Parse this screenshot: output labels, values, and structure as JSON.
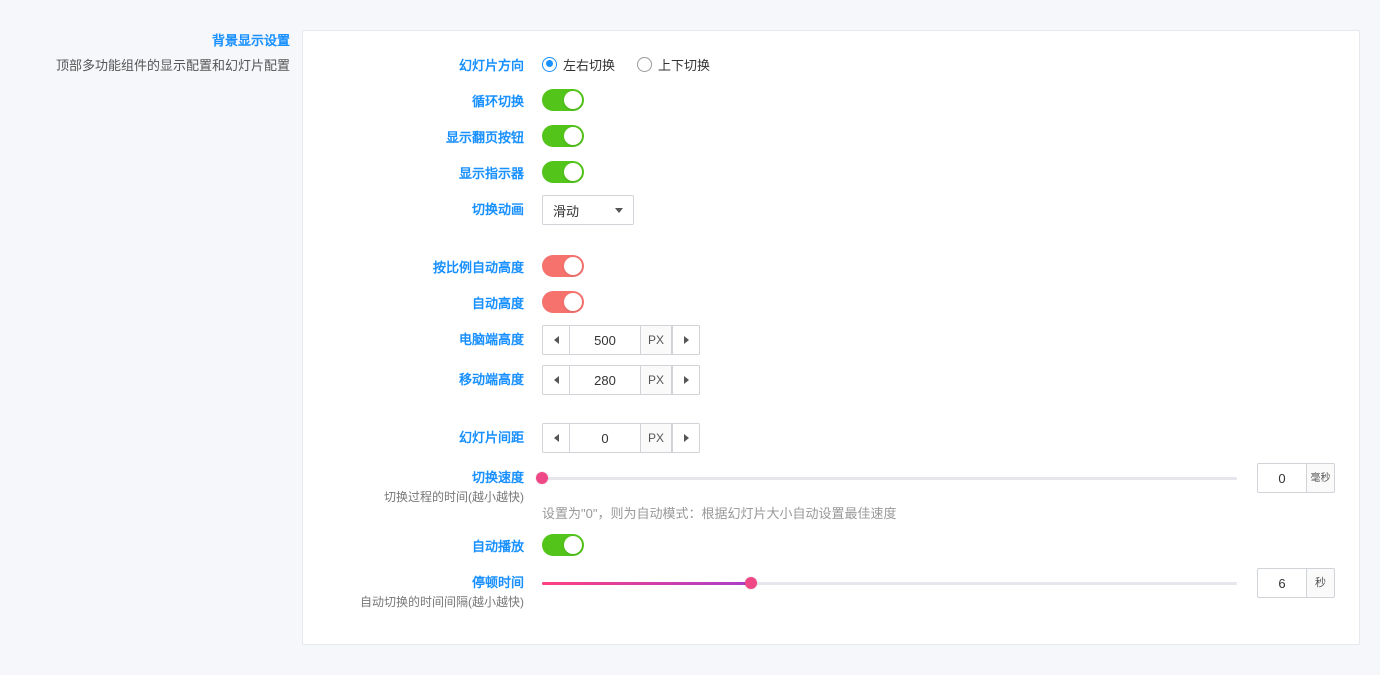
{
  "sidebar": {
    "title": "背景显示设置",
    "desc": "顶部多功能组件的显示配置和幻灯片配置"
  },
  "labels": {
    "direction": "幻灯片方向",
    "loop": "循环切换",
    "show_paging": "显示翻页按钮",
    "show_indicator": "显示指示器",
    "animation": "切换动画",
    "auto_height_ratio": "按比例自动高度",
    "auto_height": "自动高度",
    "pc_height": "电脑端高度",
    "mobile_height": "移动端高度",
    "slide_gap": "幻灯片间距",
    "speed": "切换速度",
    "speed_sub": "切换过程的时间(越小越快)",
    "autoplay": "自动播放",
    "pause": "停顿时间",
    "pause_sub": "自动切换的时间间隔(越小越快)"
  },
  "direction": {
    "opt1": "左右切换",
    "opt2": "上下切换"
  },
  "animation": {
    "selected": "滑动"
  },
  "pc_height": {
    "value": "500",
    "unit": "PX"
  },
  "mobile_height": {
    "value": "280",
    "unit": "PX"
  },
  "slide_gap": {
    "value": "0",
    "unit": "PX"
  },
  "speed": {
    "value": "0",
    "unit": "毫秒",
    "help": "设置为\"0\"，则为自动模式：根据幻灯片大小自动设置最佳速度"
  },
  "pause": {
    "value": "6",
    "unit": "秒"
  }
}
